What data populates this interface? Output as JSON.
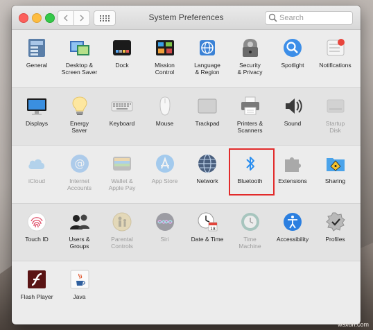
{
  "window": {
    "title": "System Preferences",
    "search_placeholder": "Search"
  },
  "sections": [
    {
      "panes": [
        {
          "id": "general",
          "label": "General",
          "icon": "general-icon",
          "enabled": true
        },
        {
          "id": "desktop",
          "label": "Desktop &\nScreen Saver",
          "icon": "desktop-screensaver-icon",
          "enabled": true
        },
        {
          "id": "dock",
          "label": "Dock",
          "icon": "dock-icon",
          "enabled": true
        },
        {
          "id": "mission",
          "label": "Mission\nControl",
          "icon": "mission-control-icon",
          "enabled": true
        },
        {
          "id": "language",
          "label": "Language\n& Region",
          "icon": "language-region-icon",
          "enabled": true
        },
        {
          "id": "security",
          "label": "Security\n& Privacy",
          "icon": "security-privacy-icon",
          "enabled": true
        },
        {
          "id": "spotlight",
          "label": "Spotlight",
          "icon": "spotlight-icon",
          "enabled": true
        },
        {
          "id": "notifications",
          "label": "Notifications",
          "icon": "notifications-icon",
          "enabled": true
        }
      ]
    },
    {
      "panes": [
        {
          "id": "displays",
          "label": "Displays",
          "icon": "displays-icon",
          "enabled": true
        },
        {
          "id": "energy",
          "label": "Energy\nSaver",
          "icon": "energy-saver-icon",
          "enabled": true
        },
        {
          "id": "keyboard",
          "label": "Keyboard",
          "icon": "keyboard-icon",
          "enabled": true
        },
        {
          "id": "mouse",
          "label": "Mouse",
          "icon": "mouse-icon",
          "enabled": true
        },
        {
          "id": "trackpad",
          "label": "Trackpad",
          "icon": "trackpad-icon",
          "enabled": true
        },
        {
          "id": "printers",
          "label": "Printers &\nScanners",
          "icon": "printers-scanners-icon",
          "enabled": true
        },
        {
          "id": "sound",
          "label": "Sound",
          "icon": "sound-icon",
          "enabled": true
        },
        {
          "id": "startup",
          "label": "Startup\nDisk",
          "icon": "startup-disk-icon",
          "enabled": false
        }
      ]
    },
    {
      "panes": [
        {
          "id": "icloud",
          "label": "iCloud",
          "icon": "icloud-icon",
          "enabled": false
        },
        {
          "id": "internet",
          "label": "Internet\nAccounts",
          "icon": "internet-accounts-icon",
          "enabled": false
        },
        {
          "id": "wallet",
          "label": "Wallet &\nApple Pay",
          "icon": "wallet-icon",
          "enabled": false
        },
        {
          "id": "appstore",
          "label": "App Store",
          "icon": "app-store-icon",
          "enabled": false
        },
        {
          "id": "network",
          "label": "Network",
          "icon": "network-icon",
          "enabled": true
        },
        {
          "id": "bluetooth",
          "label": "Bluetooth",
          "icon": "bluetooth-icon",
          "enabled": true,
          "highlighted": true
        },
        {
          "id": "extensions",
          "label": "Extensions",
          "icon": "extensions-icon",
          "enabled": true
        },
        {
          "id": "sharing",
          "label": "Sharing",
          "icon": "sharing-icon",
          "enabled": true
        }
      ]
    },
    {
      "panes": [
        {
          "id": "touchid",
          "label": "Touch ID",
          "icon": "touch-id-icon",
          "enabled": true
        },
        {
          "id": "users",
          "label": "Users &\nGroups",
          "icon": "users-groups-icon",
          "enabled": true
        },
        {
          "id": "parental",
          "label": "Parental\nControls",
          "icon": "parental-controls-icon",
          "enabled": false
        },
        {
          "id": "siri",
          "label": "Siri",
          "icon": "siri-icon",
          "enabled": false
        },
        {
          "id": "datetime",
          "label": "Date & Time",
          "icon": "date-time-icon",
          "enabled": true
        },
        {
          "id": "timemachine",
          "label": "Time\nMachine",
          "icon": "time-machine-icon",
          "enabled": false
        },
        {
          "id": "accessibility",
          "label": "Accessibility",
          "icon": "accessibility-icon",
          "enabled": true
        },
        {
          "id": "profiles",
          "label": "Profiles",
          "icon": "profiles-icon",
          "enabled": true
        }
      ]
    },
    {
      "panes": [
        {
          "id": "flash",
          "label": "Flash Player",
          "icon": "flash-player-icon",
          "enabled": true
        },
        {
          "id": "java",
          "label": "Java",
          "icon": "java-icon",
          "enabled": true
        }
      ]
    }
  ],
  "colors": {
    "highlight": "#e22a2a",
    "accent": "#2b8ff0"
  },
  "watermark": "wsxdn.com"
}
